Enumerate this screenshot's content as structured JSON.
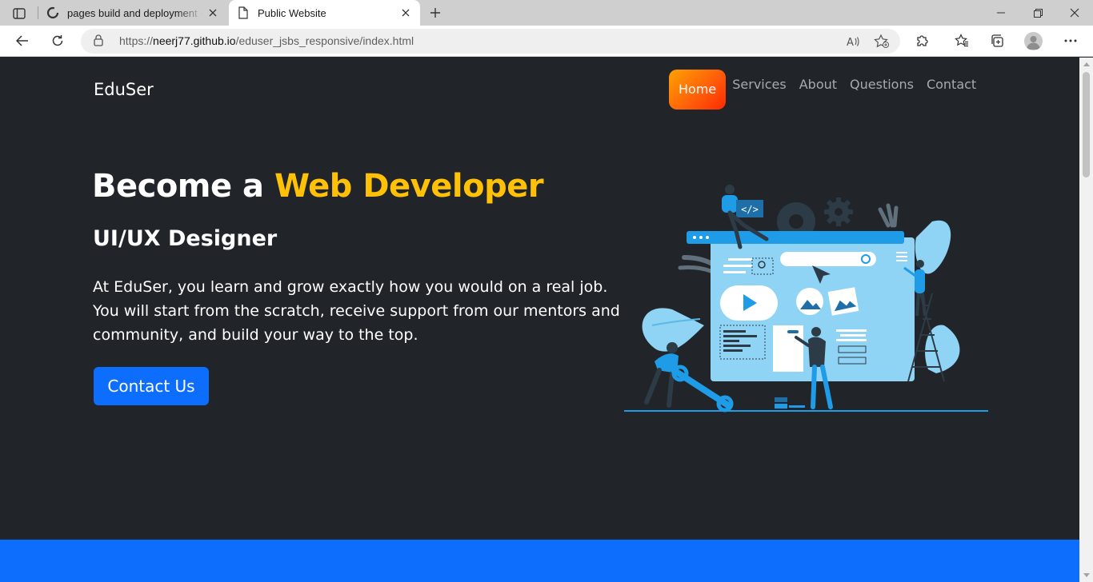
{
  "browser": {
    "tabs": [
      {
        "title": "pages build and deployment · ne",
        "favicon": "github-icon",
        "active": false
      },
      {
        "title": "Public Website",
        "favicon": "page-icon",
        "active": true
      }
    ],
    "url_prefix": "https://",
    "url_host": "neerj77.github.io",
    "url_path": "/eduser_jsbs_responsive/index.html",
    "icons": [
      "back-icon",
      "refresh-icon",
      "lock-icon",
      "read-aloud-icon",
      "add-favorite-icon",
      "extensions-icon",
      "favorites-icon",
      "collections-icon",
      "profile-avatar",
      "more-icon",
      "minimize-icon",
      "maximize-icon",
      "close-icon",
      "new-tab-icon",
      "tab-actions-icon"
    ]
  },
  "site": {
    "brand": "EduSer",
    "nav": [
      {
        "label": "Home",
        "active": true
      },
      {
        "label": "Services",
        "active": false
      },
      {
        "label": "About",
        "active": false
      },
      {
        "label": "Questions",
        "active": false
      },
      {
        "label": "Contact",
        "active": false
      }
    ],
    "hero": {
      "title_part1": "Become a ",
      "title_highlight": "Web Developer",
      "subtitle": "UI/UX Designer",
      "lead": "At EduSer, you learn and grow exactly how you would on a real job. You will start from the scratch, receive support from our mentors and community, and build your way to the top.",
      "cta_label": "Contact Us",
      "illustration": "web-development-team-illustration"
    }
  },
  "colors": {
    "page_bg": "#212529",
    "accent_yellow": "#ffc107",
    "primary_blue": "#0d6efd",
    "home_gradient_start": "#ffa200",
    "home_gradient_end": "#ff2a00",
    "nav_link": "#a8abad"
  }
}
